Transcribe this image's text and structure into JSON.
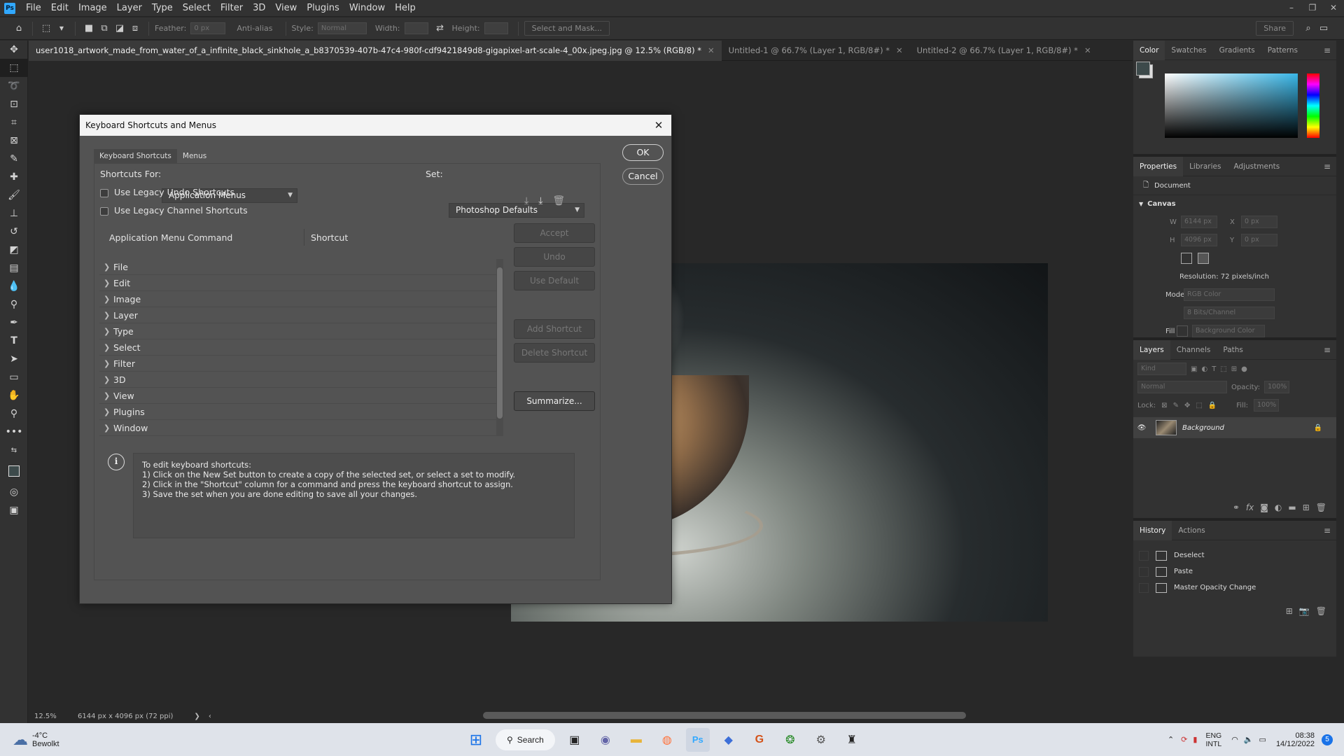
{
  "menubar": {
    "logo": "Ps",
    "items": [
      "File",
      "Edit",
      "Image",
      "Layer",
      "Type",
      "Select",
      "Filter",
      "3D",
      "View",
      "Plugins",
      "Window",
      "Help"
    ]
  },
  "options_bar": {
    "feather_label": "Feather:",
    "feather_value": "0 px",
    "anti_alias": "Anti-alias",
    "style_label": "Style:",
    "style_value": "Normal",
    "width_label": "Width:",
    "height_label": "Height:",
    "select_mask": "Select and Mask...",
    "share": "Share"
  },
  "tabs": [
    {
      "label": "user1018_artwork_made_from_water_of_a_infinite_black_sinkhole_a_b8370539-407b-47c4-980f-cdf9421849d8-gigapixel-art-scale-4_00x.jpeg.jpg @ 12.5% (RGB/8) *"
    },
    {
      "label": "Untitled-1 @ 66.7% (Layer 1, RGB/8#) *"
    },
    {
      "label": "Untitled-2 @ 66.7% (Layer 1, RGB/8#) *"
    }
  ],
  "status": {
    "zoom": "12.5%",
    "doc_info": "6144 px x 4096 px (72 ppi)"
  },
  "color_panel": {
    "tabs": [
      "Color",
      "Swatches",
      "Gradients",
      "Patterns"
    ]
  },
  "properties_panel": {
    "tabs": [
      "Properties",
      "Libraries",
      "Adjustments"
    ],
    "doc_label": "Document",
    "canvas_label": "Canvas",
    "w_label": "W",
    "w_value": "6144 px",
    "x_label": "X",
    "x_value": "0 px",
    "h_label": "H",
    "h_value": "4096 px",
    "y_label": "Y",
    "y_value": "0 px",
    "resolution": "Resolution: 72 pixels/inch",
    "mode_label": "Mode",
    "mode_value": "RGB Color",
    "bits_value": "8 Bits/Channel",
    "fill_label": "Fill",
    "fill_value": "Background Color"
  },
  "layers_panel": {
    "tabs": [
      "Layers",
      "Channels",
      "Paths"
    ],
    "kind": "Kind",
    "blend": "Normal",
    "opacity_label": "Opacity:",
    "opacity_value": "100%",
    "lock_label": "Lock:",
    "fill_label": "Fill:",
    "fill_value": "100%",
    "layers": [
      {
        "name": "Background"
      }
    ]
  },
  "history_panel": {
    "tabs": [
      "History",
      "Actions"
    ],
    "items": [
      "Deselect",
      "Paste",
      "Master Opacity Change"
    ]
  },
  "dialog": {
    "title": "Keyboard Shortcuts and Menus",
    "tabs": [
      "Keyboard Shortcuts",
      "Menus"
    ],
    "shortcuts_for_label": "Shortcuts For:",
    "shortcuts_for_value": "Application Menus",
    "set_label": "Set:",
    "set_value": "Photoshop Defaults",
    "legacy_undo": "Use Legacy Undo Shortcuts",
    "legacy_channel": "Use Legacy Channel Shortcuts",
    "col_command": "Application Menu Command",
    "col_shortcut": "Shortcut",
    "commands": [
      "File",
      "Edit",
      "Image",
      "Layer",
      "Type",
      "Select",
      "Filter",
      "3D",
      "View",
      "Plugins",
      "Window"
    ],
    "ok": "OK",
    "cancel": "Cancel",
    "accept": "Accept",
    "undo": "Undo",
    "use_default": "Use Default",
    "add_shortcut": "Add Shortcut",
    "delete_shortcut": "Delete Shortcut",
    "summarize": "Summarize...",
    "info_lines": [
      "To edit keyboard shortcuts:",
      "1) Click on the New Set button to create a copy of the selected set, or select a set to modify.",
      "2) Click in the \"Shortcut\" column for a command and press the keyboard shortcut to assign.",
      "3) Save the set when you are done editing to save all your changes."
    ]
  },
  "taskbar": {
    "weather_temp": "-4°C",
    "weather_desc": "Bewolkt",
    "search": "Search",
    "lang1": "ENG",
    "lang2": "INTL",
    "time": "08:38",
    "date": "14/12/2022",
    "notif": "5"
  }
}
